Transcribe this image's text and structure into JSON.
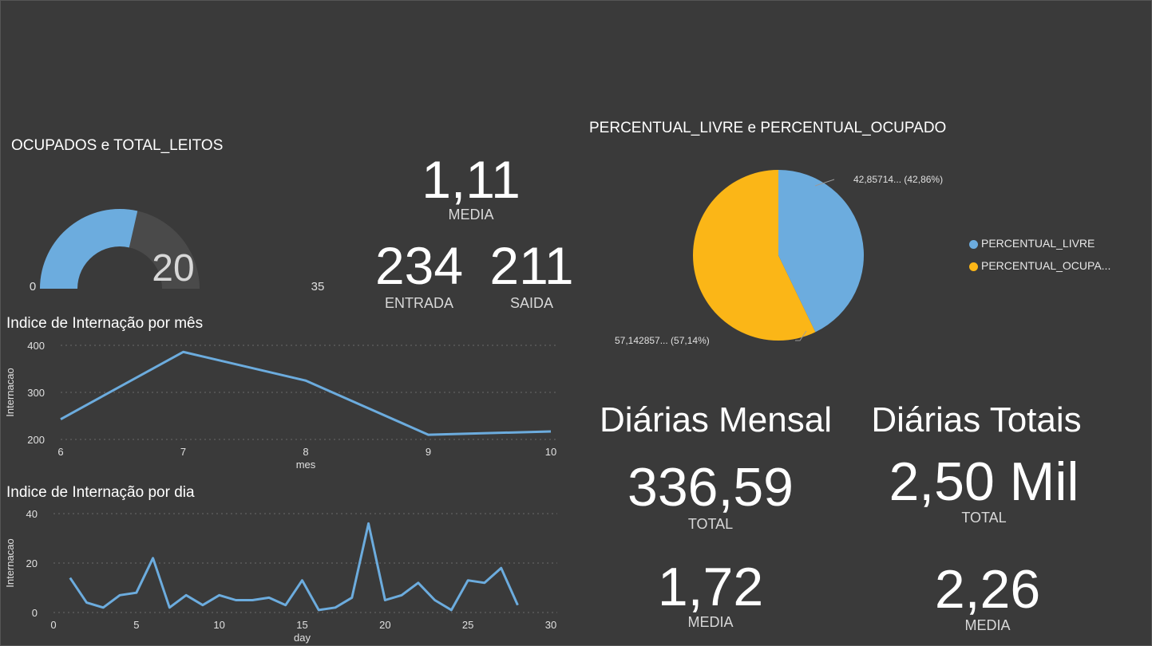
{
  "gauge": {
    "title": "OCUPADOS e TOTAL_LEITOS",
    "value": 20,
    "min": 0,
    "max": 35,
    "fill_color": "#6cacde"
  },
  "kpis": {
    "media_value": "1,11",
    "media_label": "MEDIA",
    "entrada_value": "234",
    "entrada_label": "ENTRADA",
    "saida_value": "211",
    "saida_label": "SAIDA"
  },
  "pie": {
    "title": "PERCENTUAL_LIVRE e PERCENTUAL_OCUPADO",
    "label_livre": "42,85714... (42,86%)",
    "label_ocupado": "57,142857... (57,14%)",
    "legend": [
      {
        "name": "PERCENTUAL_LIVRE",
        "color": "#6cacde"
      },
      {
        "name": "PERCENTUAL_OCUPA...",
        "color": "#fbb617"
      }
    ]
  },
  "diarias": {
    "mensal_title": "Diárias Mensal",
    "mensal_total_value": "336,59",
    "mensal_total_label": "TOTAL",
    "mensal_media_value": "1,72",
    "mensal_media_label": "MEDIA",
    "totais_title": "Diárias Totais",
    "totais_total_value": "2,50 Mil",
    "totais_total_label": "TOTAL",
    "totais_media_value": "2,26",
    "totais_media_label": "MEDIA"
  },
  "chart_data": [
    {
      "type": "line",
      "title": "Indice de Internação por mês",
      "xlabel": "mes",
      "ylabel": "Internacao",
      "x": [
        6,
        7,
        8,
        9,
        10
      ],
      "series": [
        {
          "values": [
            243,
            386,
            325,
            210,
            217
          ]
        }
      ],
      "xticks": [
        6,
        7,
        8,
        9,
        10
      ],
      "yticks": [
        200,
        300,
        400
      ],
      "xlim": [
        6,
        10
      ],
      "ylim": [
        200,
        400
      ],
      "grid": true,
      "color": "#6cacde"
    },
    {
      "type": "line",
      "title": "Indice de Internação por dia",
      "xlabel": "day",
      "ylabel": "Internacao",
      "x": [
        1,
        2,
        3,
        4,
        5,
        6,
        7,
        8,
        9,
        10,
        11,
        12,
        13,
        14,
        15,
        16,
        17,
        18,
        19,
        20,
        21,
        22,
        23,
        24,
        25,
        26,
        27,
        28
      ],
      "series": [
        {
          "values": [
            14,
            4,
            2,
            7,
            8,
            22,
            2,
            7,
            3,
            7,
            5,
            5,
            6,
            3,
            13,
            1,
            2,
            6,
            36,
            5,
            7,
            12,
            5,
            1,
            13,
            12,
            18,
            3
          ]
        }
      ],
      "xticks": [
        0,
        5,
        10,
        15,
        20,
        25,
        30
      ],
      "yticks": [
        0,
        20,
        40
      ],
      "xlim": [
        0,
        30
      ],
      "ylim": [
        0,
        40
      ],
      "grid": true,
      "color": "#6cacde"
    },
    {
      "type": "pie",
      "title": "PERCENTUAL_LIVRE e PERCENTUAL_OCUPADO",
      "categories": [
        "PERCENTUAL_LIVRE",
        "PERCENTUAL_OCUPA..."
      ],
      "values": [
        42.86,
        57.14
      ],
      "colors": [
        "#6cacde",
        "#fbb617"
      ],
      "legend": "right"
    }
  ]
}
